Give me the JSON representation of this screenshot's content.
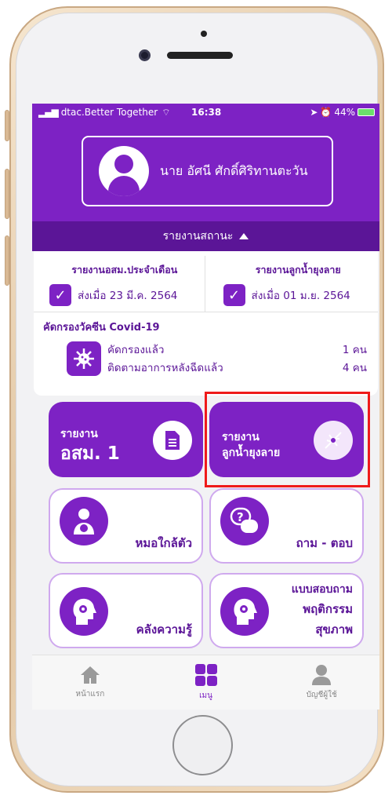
{
  "device": {
    "status": {
      "carrier": "dtac.Better Together",
      "time": "16:38",
      "battery": "44%"
    }
  },
  "profile": {
    "name": "นาย อัศนี ศักดิ์ศิริทานตะวัน"
  },
  "status_toggle": {
    "label": "รายงานสถานะ"
  },
  "reports": [
    {
      "title": "รายงานอสม.ประจำเดือน",
      "sent": "ส่งเมื่อ 23 มี.ค. 2564"
    },
    {
      "title": "รายงานลูกน้ำยุงลาย",
      "sent": "ส่งเมื่อ 01 ม.ย. 2564"
    }
  ],
  "covid": {
    "title": "คัดกรองวัคซีน Covid-19",
    "items": [
      {
        "label": "คัดกรองแล้ว",
        "value": "1 คน"
      },
      {
        "label": "ติดตามอาการหลังฉีดแล้ว",
        "value": "4 คน"
      }
    ]
  },
  "tiles": {
    "osm_report": {
      "line1": "รายงาน",
      "line2": "อสม. 1"
    },
    "larvae_report": {
      "line1": "รายงาน",
      "line2": "ลูกน้ำยุงลาย"
    },
    "doctor_near": {
      "label": "หมอใกล้ตัว"
    },
    "qa": {
      "label": "ถาม - ตอบ"
    },
    "knowledge": {
      "label": "คลังความรู้"
    },
    "survey": {
      "line1": "แบบสอบถาม",
      "line2": "พฤติกรรม",
      "line3": "สุขภาพ"
    }
  },
  "tabbar": [
    {
      "label": "หน้าแรก"
    },
    {
      "label": "เมนู"
    },
    {
      "label": "บัญชีผู้ใช้"
    }
  ],
  "colors": {
    "primary": "#7d22c4",
    "dark": "#5b1597",
    "highlight": "#ef1a1a"
  }
}
